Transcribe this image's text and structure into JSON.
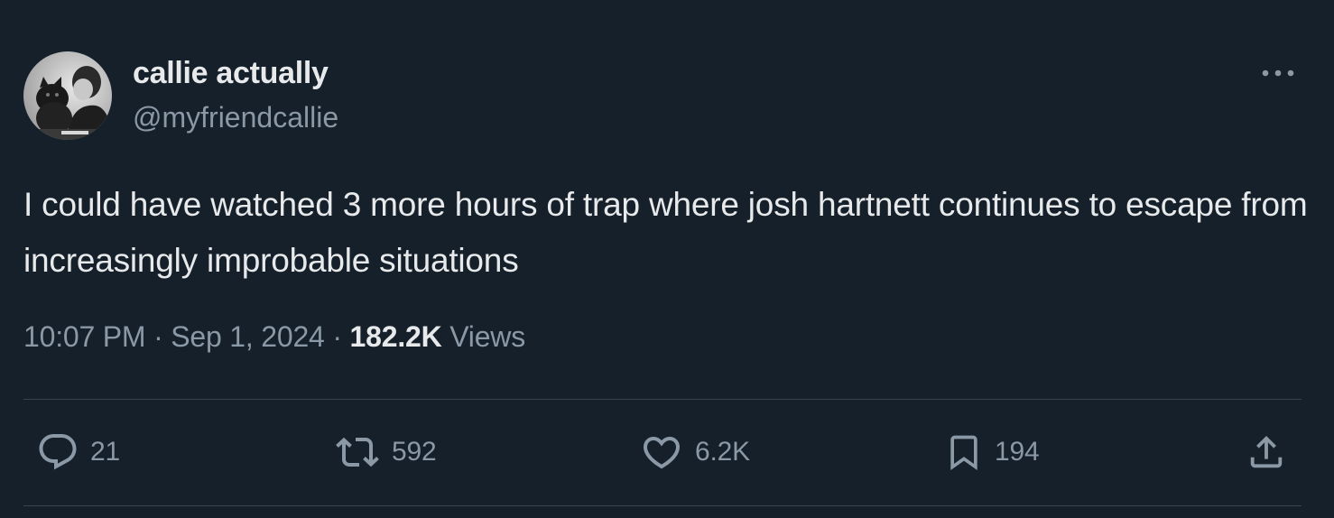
{
  "author": {
    "display_name": "callie actually",
    "handle": "@myfriendcallie"
  },
  "tweet": {
    "text": "I could have watched 3 more hours of trap where josh hartnett continues to escape from increasingly improbable situations",
    "time": "10:07 PM",
    "separator": "·",
    "date": "Sep 1, 2024",
    "views_count": "182.2K",
    "views_label": "Views"
  },
  "actions": {
    "replies": "21",
    "reposts": "592",
    "likes": "6.2K",
    "bookmarks": "194"
  },
  "icons": {
    "more": "more-horizontal-icon",
    "reply": "reply-bubble-icon",
    "repost": "repost-arrows-icon",
    "like": "heart-icon",
    "bookmark": "bookmark-icon",
    "share": "share-upload-icon"
  },
  "colors": {
    "background": "#15202b",
    "text_primary": "#e7e9ea",
    "text_secondary": "#8b98a5",
    "divider": "#38444d"
  }
}
